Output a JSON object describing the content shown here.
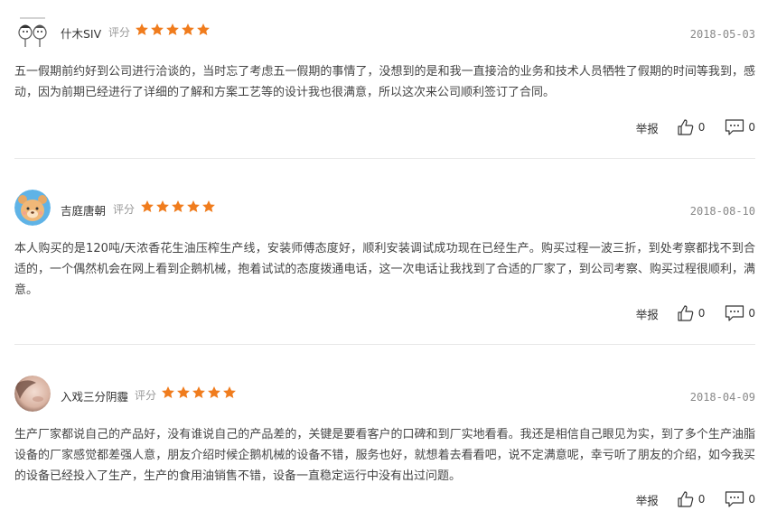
{
  "reviews": [
    {
      "username": "什木SIV",
      "score_label": "评分",
      "rating": 5,
      "date": "2018-05-03",
      "content": "五一假期前约好到公司进行洽谈的，当时忘了考虑五一假期的事情了，没想到的是和我一直接洽的业务和技术人员牺牲了假期的时间等我到，感动，因为前期已经进行了详细的了解和方案工艺等的设计我也很满意，所以这次来公司顺利签订了合同。",
      "report_label": "举报",
      "likes": "0",
      "comments": "0",
      "avatar_icon": "cartoon-couple-avatar"
    },
    {
      "username": "吉庭唐朝",
      "score_label": "评分",
      "rating": 5,
      "date": "2018-08-10",
      "content": "本人购买的是120吨/天浓香花生油压榨生产线，安装师傅态度好，顺利安装调试成功现在已经生产。购买过程一波三折，到处考察都找不到合适的，一个偶然机会在网上看到企鹅机械，抱着试试的态度拨通电话，这一次电话让我找到了合适的厂家了，到公司考察、购买过程很顺利，满意。",
      "report_label": "举报",
      "likes": "0",
      "comments": "0",
      "avatar_icon": "bear-avatar"
    },
    {
      "username": "入戏三分阴霾",
      "score_label": "评分",
      "rating": 5,
      "date": "2018-04-09",
      "content": "生产厂家都说自己的产品好，没有谁说自己的产品差的，关键是要看客户的口碑和到厂实地看看。我还是相信自己眼见为实，到了多个生产油脂设备的厂家感觉都差强人意，朋友介绍时候企鹅机械的设备不错，服务也好，就想着去看看吧，说不定满意呢，幸亏听了朋友的介绍，如今我买的设备已经投入了生产，生产的食用油销售不错，设备一直稳定运行中没有出过问题。",
      "report_label": "举报",
      "likes": "0",
      "comments": "0",
      "avatar_icon": "photo-avatar"
    }
  ],
  "colors": {
    "star": "#f07c1d",
    "text": "#444444",
    "muted": "#999999",
    "divider": "#e8e8e8"
  }
}
